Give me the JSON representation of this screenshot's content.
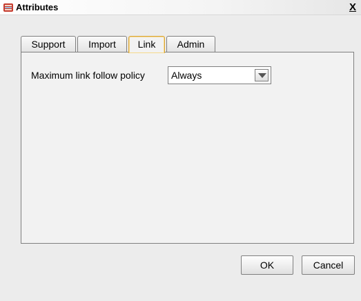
{
  "window": {
    "title": "Attributes",
    "close_label": "X"
  },
  "tabs": [
    {
      "label": "Support",
      "active": false
    },
    {
      "label": "Import",
      "active": false
    },
    {
      "label": "Link",
      "active": true
    },
    {
      "label": "Admin",
      "active": false
    }
  ],
  "link_panel": {
    "policy_label": "Maximum link follow policy",
    "policy_value": "Always"
  },
  "buttons": {
    "ok_label": "OK",
    "cancel_label": "Cancel"
  },
  "colors": {
    "active_tab_border": "#d8a53c",
    "background": "#ececec"
  }
}
